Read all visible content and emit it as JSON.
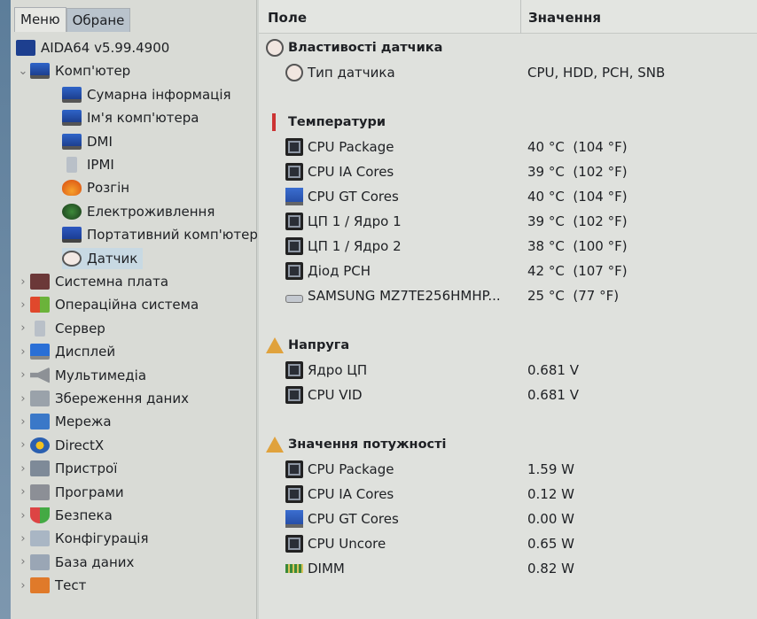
{
  "tabs": [
    "Меню",
    "Обране"
  ],
  "tree": [
    {
      "label": "AIDA64 v5.99.4900",
      "level": 0,
      "icon": "aida64-logo-icon",
      "chev": ""
    },
    {
      "label": "Комп'ютер",
      "level": 1,
      "icon": "computer-icon",
      "chev": "expanded"
    },
    {
      "label": "Сумарна інформація",
      "level": 2,
      "icon": "computer-icon"
    },
    {
      "label": "Ім'я комп'ютера",
      "level": 2,
      "icon": "computer-icon"
    },
    {
      "label": "DMI",
      "level": 2,
      "icon": "computer-icon"
    },
    {
      "label": "IPMI",
      "level": 2,
      "icon": "server-tower-icon"
    },
    {
      "label": "Розгін",
      "level": 2,
      "icon": "flame-icon"
    },
    {
      "label": "Електроживлення",
      "level": 2,
      "icon": "power-plug-icon"
    },
    {
      "label": "Портативний комп'ютер",
      "level": 2,
      "icon": "laptop-icon"
    },
    {
      "label": "Датчик",
      "level": 2,
      "icon": "gauge-icon",
      "selected": true
    },
    {
      "label": "Системна плата",
      "level": 1,
      "icon": "motherboard-icon",
      "chev": "collapsed"
    },
    {
      "label": "Операційна система",
      "level": 1,
      "icon": "windows-logo-icon",
      "chev": "collapsed"
    },
    {
      "label": "Сервер",
      "level": 1,
      "icon": "server-tower-icon",
      "chev": "collapsed"
    },
    {
      "label": "Дисплей",
      "level": 1,
      "icon": "monitor-icon",
      "chev": "collapsed"
    },
    {
      "label": "Мультимедіа",
      "level": 1,
      "icon": "speaker-icon",
      "chev": "collapsed"
    },
    {
      "label": "Збереження даних",
      "level": 1,
      "icon": "storage-icon",
      "chev": "collapsed"
    },
    {
      "label": "Мережа",
      "level": 1,
      "icon": "network-icon",
      "chev": "collapsed"
    },
    {
      "label": "DirectX",
      "level": 1,
      "icon": "directx-icon",
      "chev": "collapsed"
    },
    {
      "label": "Пристрої",
      "level": 1,
      "icon": "devices-icon",
      "chev": "collapsed"
    },
    {
      "label": "Програми",
      "level": 1,
      "icon": "programs-icon",
      "chev": "collapsed"
    },
    {
      "label": "Безпека",
      "level": 1,
      "icon": "security-shield-icon",
      "chev": "collapsed"
    },
    {
      "label": "Конфігурація",
      "level": 1,
      "icon": "config-icon",
      "chev": "collapsed"
    },
    {
      "label": "База даних",
      "level": 1,
      "icon": "database-icon",
      "chev": "collapsed"
    },
    {
      "label": "Тест",
      "level": 1,
      "icon": "benchmark-icon",
      "chev": "collapsed"
    }
  ],
  "columns": {
    "field": "Поле",
    "value": "Значення"
  },
  "rows": [
    {
      "type": "section",
      "field": "Властивості датчика",
      "icon": "gauge-icon"
    },
    {
      "type": "item",
      "field": "Тип датчика",
      "value": "CPU, HDD, PCH, SNB",
      "icon": "gauge-icon"
    },
    {
      "type": "blank"
    },
    {
      "type": "section",
      "field": "Температури",
      "icon": "thermometer-icon"
    },
    {
      "type": "item",
      "field": "CPU Package",
      "value": "40 °C  (104 °F)",
      "icon": "chip-icon"
    },
    {
      "type": "item",
      "field": "CPU IA Cores",
      "value": "39 °C  (102 °F)",
      "icon": "chip-icon"
    },
    {
      "type": "item",
      "field": "CPU GT Cores",
      "value": "40 °C  (104 °F)",
      "icon": "monitor-icon"
    },
    {
      "type": "item",
      "field": "ЦП 1 / Ядро 1",
      "value": "39 °C  (102 °F)",
      "icon": "chip-icon"
    },
    {
      "type": "item",
      "field": "ЦП 1 / Ядро 2",
      "value": "38 °C  (100 °F)",
      "icon": "chip-icon"
    },
    {
      "type": "item",
      "field": "Діод PCH",
      "value": "42 °C  (107 °F)",
      "icon": "chip-icon"
    },
    {
      "type": "item",
      "field": "SAMSUNG MZ7TE256HMHP...",
      "value": "25 °C  (77 °F)",
      "icon": "disk-icon"
    },
    {
      "type": "blank"
    },
    {
      "type": "section",
      "field": "Напруга",
      "icon": "warning-icon"
    },
    {
      "type": "item",
      "field": "Ядро ЦП",
      "value": "0.681 V",
      "icon": "chip-icon"
    },
    {
      "type": "item",
      "field": "CPU VID",
      "value": "0.681 V",
      "icon": "chip-icon"
    },
    {
      "type": "blank"
    },
    {
      "type": "section",
      "field": "Значення потужності",
      "icon": "warning-icon"
    },
    {
      "type": "item",
      "field": "CPU Package",
      "value": "1.59 W",
      "icon": "chip-icon"
    },
    {
      "type": "item",
      "field": "CPU IA Cores",
      "value": "0.12 W",
      "icon": "chip-icon"
    },
    {
      "type": "item",
      "field": "CPU GT Cores",
      "value": "0.00 W",
      "icon": "monitor-icon"
    },
    {
      "type": "item",
      "field": "CPU Uncore",
      "value": "0.65 W",
      "icon": "chip-icon"
    },
    {
      "type": "item",
      "field": "DIMM",
      "value": "0.82 W",
      "icon": "memory-module-icon"
    }
  ]
}
